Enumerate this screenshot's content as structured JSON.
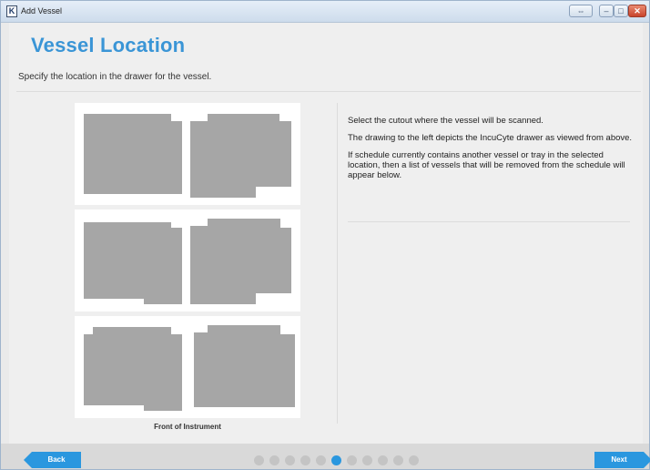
{
  "window": {
    "title": "Add Vessel",
    "app_icon_letter": "K"
  },
  "page": {
    "title": "Vessel Location",
    "subtitle": "Specify the location in the drawer for the vessel."
  },
  "drawer": {
    "front_label": "Front of Instrument",
    "cutout_color": "#a6a6a6",
    "rows": 3,
    "cutouts_per_row": 2
  },
  "info": {
    "paragraph_1": "Select the cutout where the vessel will be scanned.",
    "paragraph_2": "The drawing to the left depicts the IncuCyte drawer as viewed from above.",
    "paragraph_3": "If schedule currently contains another vessel or tray in the selected location, then a list of vessels that will be removed from the schedule will appear below."
  },
  "footer": {
    "back_label": "Back",
    "next_label": "Next",
    "step_total": 11,
    "step_current": 6
  },
  "colors": {
    "accent": "#2a97df",
    "title": "#3a95d6"
  }
}
